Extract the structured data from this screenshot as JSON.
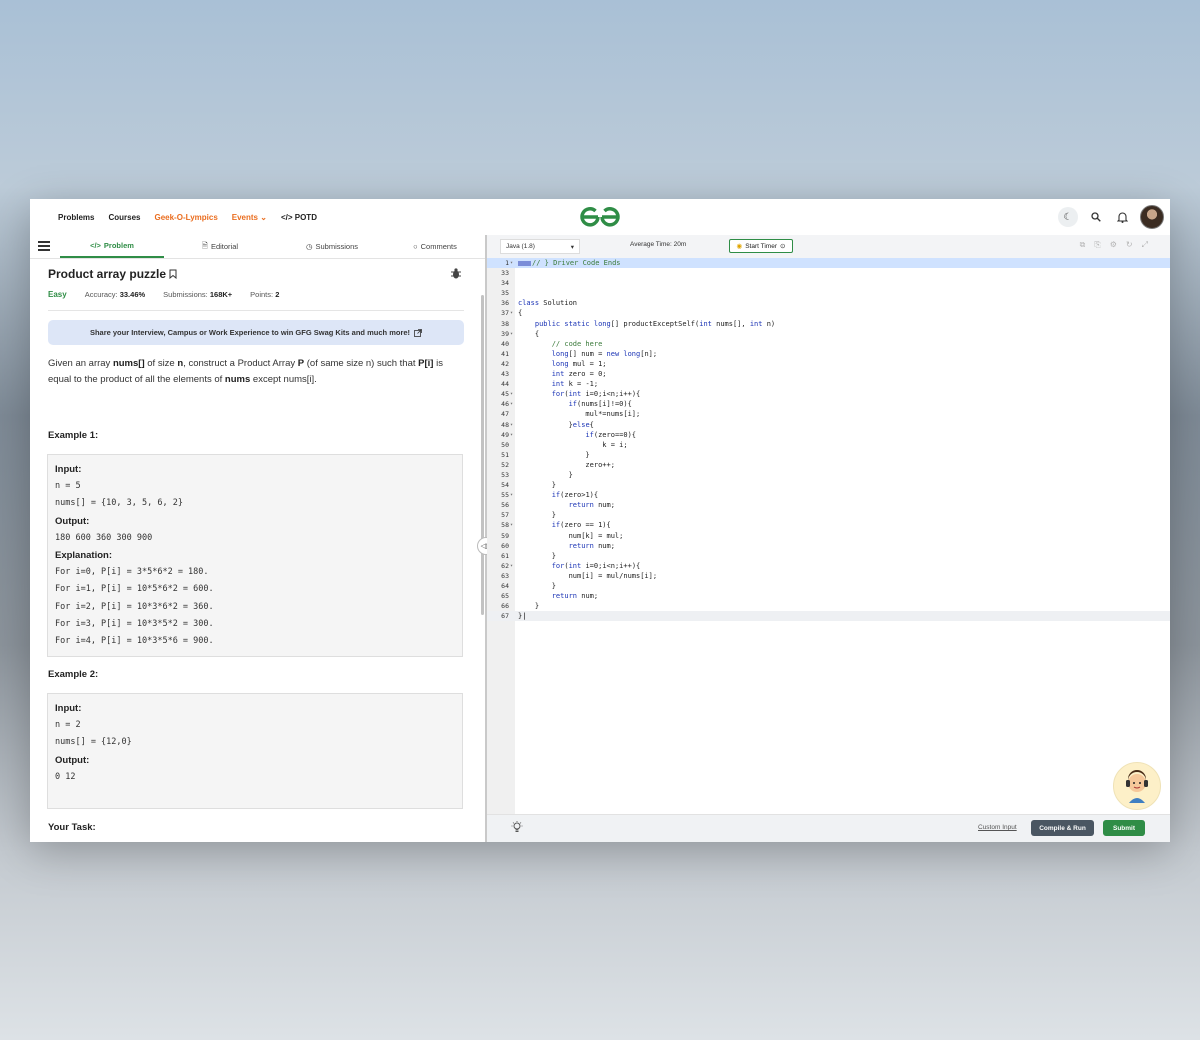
{
  "nav": {
    "links": [
      "Problems",
      "Courses",
      "Geek-O-Lympics",
      "Events",
      "POTD"
    ],
    "events_chevron": "⌄",
    "potd_prefix": "</>"
  },
  "tabs": {
    "problem": "Problem",
    "editorial": "Editorial",
    "submissions": "Submissions",
    "comments": "Comments"
  },
  "problem": {
    "title": "Product array puzzle",
    "difficulty": "Easy",
    "accuracy_label": "Accuracy:",
    "accuracy": "33.46%",
    "submissions_label": "Submissions:",
    "submissions": "168K+",
    "points_label": "Points:",
    "points": "2",
    "banner": "Share your Interview, Campus or Work Experience to win GFG Swag Kits and much more!",
    "desc": {
      "p1": "Given an array ",
      "b1": "nums[]",
      "p2": " of size ",
      "b2": "n",
      "p3": ", construct a Product Array ",
      "b3": "P",
      "p4": " (of same size n) such that ",
      "b4": "P[i]",
      "p5": " is equal to the product of all the elements of ",
      "b5": "nums",
      "p6": " except nums[i]."
    },
    "example1": {
      "heading": "Example 1:",
      "input_label": "Input:",
      "input_lines": [
        "n = 5",
        "nums[] = {10, 3, 5, 6, 2}"
      ],
      "output_label": "Output:",
      "output": "180 600 360 300 900",
      "explanation_label": "Explanation:",
      "explanation_lines": [
        "For i=0, P[i] = 3*5*6*2 = 180.",
        "For i=1, P[i] = 10*5*6*2 = 600.",
        "For i=2, P[i] = 10*3*6*2 = 360.",
        "For i=3, P[i] = 10*3*5*2 = 300.",
        "For i=4, P[i] = 10*3*5*6 = 900."
      ]
    },
    "example2": {
      "heading": "Example 2:",
      "input_label": "Input:",
      "input_lines": [
        "n = 2",
        "nums[] = {12,0}"
      ],
      "output_label": "Output:",
      "output": "0 12"
    },
    "your_task": "Your Task:"
  },
  "editor": {
    "language": "Java (1.8)",
    "avg_time": "Average Time: 20m",
    "start_timer": "Start Timer",
    "lines": [
      {
        "n": "1",
        "fold": true,
        "segs": [
          [
            "marker",
            ""
          ],
          [
            "cm",
            "// } Driver Code Ends"
          ]
        ],
        "hl": true
      },
      {
        "n": "33",
        "segs": []
      },
      {
        "n": "34",
        "segs": []
      },
      {
        "n": "35",
        "segs": []
      },
      {
        "n": "36",
        "segs": [
          [
            "kw",
            "class"
          ],
          [
            "",
            " Solution"
          ]
        ]
      },
      {
        "n": "37",
        "fold": true,
        "segs": [
          [
            "",
            "{"
          ]
        ]
      },
      {
        "n": "38",
        "segs": [
          [
            "",
            "    "
          ],
          [
            "kw",
            "public static long"
          ],
          [
            "",
            "[] productExceptSelf("
          ],
          [
            "kw",
            "int"
          ],
          [
            "",
            " nums[], "
          ],
          [
            "kw",
            "int"
          ],
          [
            "",
            " n)"
          ]
        ]
      },
      {
        "n": "39",
        "fold": true,
        "segs": [
          [
            "",
            "    {"
          ]
        ]
      },
      {
        "n": "40",
        "segs": [
          [
            "",
            "        "
          ],
          [
            "cm",
            "// code here"
          ]
        ]
      },
      {
        "n": "41",
        "segs": [
          [
            "",
            "        "
          ],
          [
            "kw",
            "long"
          ],
          [
            "",
            "[] num = "
          ],
          [
            "kw",
            "new long"
          ],
          [
            "",
            "[n];"
          ]
        ]
      },
      {
        "n": "42",
        "segs": [
          [
            "",
            "        "
          ],
          [
            "kw",
            "long"
          ],
          [
            "",
            " mul = 1;"
          ]
        ]
      },
      {
        "n": "43",
        "segs": [
          [
            "",
            "        "
          ],
          [
            "kw",
            "int"
          ],
          [
            "",
            " zero = 0;"
          ]
        ]
      },
      {
        "n": "44",
        "segs": [
          [
            "",
            "        "
          ],
          [
            "kw",
            "int"
          ],
          [
            "",
            " k = -1;"
          ]
        ]
      },
      {
        "n": "45",
        "fold": true,
        "segs": [
          [
            "",
            "        "
          ],
          [
            "kw",
            "for"
          ],
          [
            "",
            "("
          ],
          [
            "kw",
            "int"
          ],
          [
            "",
            " i=0;i<n;i++){"
          ]
        ]
      },
      {
        "n": "46",
        "fold": true,
        "segs": [
          [
            "",
            "            "
          ],
          [
            "kw",
            "if"
          ],
          [
            "",
            "(nums[i]!=0){"
          ]
        ]
      },
      {
        "n": "47",
        "segs": [
          [
            "",
            "                mul*=nums[i];"
          ]
        ]
      },
      {
        "n": "48",
        "fold": true,
        "segs": [
          [
            "",
            "            }"
          ],
          [
            "kw",
            "else"
          ],
          [
            "",
            "{"
          ]
        ]
      },
      {
        "n": "49",
        "fold": true,
        "segs": [
          [
            "",
            "                "
          ],
          [
            "kw",
            "if"
          ],
          [
            "",
            "(zero==0){"
          ]
        ]
      },
      {
        "n": "50",
        "segs": [
          [
            "",
            "                    k = i;"
          ]
        ]
      },
      {
        "n": "51",
        "segs": [
          [
            "",
            "                }"
          ]
        ]
      },
      {
        "n": "52",
        "segs": [
          [
            "",
            "                zero++;"
          ]
        ]
      },
      {
        "n": "53",
        "segs": [
          [
            "",
            "            }"
          ]
        ]
      },
      {
        "n": "54",
        "segs": [
          [
            "",
            "        }"
          ]
        ]
      },
      {
        "n": "55",
        "fold": true,
        "segs": [
          [
            "",
            "        "
          ],
          [
            "kw",
            "if"
          ],
          [
            "",
            "(zero>1){"
          ]
        ]
      },
      {
        "n": "56",
        "segs": [
          [
            "",
            "            "
          ],
          [
            "kw",
            "return"
          ],
          [
            "",
            " num;"
          ]
        ]
      },
      {
        "n": "57",
        "segs": [
          [
            "",
            "        }"
          ]
        ]
      },
      {
        "n": "58",
        "fold": true,
        "segs": [
          [
            "",
            "        "
          ],
          [
            "kw",
            "if"
          ],
          [
            "",
            "(zero == 1){"
          ]
        ]
      },
      {
        "n": "59",
        "segs": [
          [
            "",
            "            num[k] = mul;"
          ]
        ]
      },
      {
        "n": "60",
        "segs": [
          [
            "",
            "            "
          ],
          [
            "kw",
            "return"
          ],
          [
            "",
            " num;"
          ]
        ]
      },
      {
        "n": "61",
        "segs": [
          [
            "",
            "        }"
          ]
        ]
      },
      {
        "n": "62",
        "fold": true,
        "segs": [
          [
            "",
            "        "
          ],
          [
            "kw",
            "for"
          ],
          [
            "",
            "("
          ],
          [
            "kw",
            "int"
          ],
          [
            "",
            " i=0;i<n;i++){"
          ]
        ]
      },
      {
        "n": "63",
        "segs": [
          [
            "",
            "            num[i] = mul/nums[i];"
          ]
        ]
      },
      {
        "n": "64",
        "segs": [
          [
            "",
            "        }"
          ]
        ]
      },
      {
        "n": "65",
        "segs": [
          [
            "",
            "        "
          ],
          [
            "kw",
            "return"
          ],
          [
            "",
            " num;"
          ]
        ]
      },
      {
        "n": "66",
        "segs": [
          [
            "",
            "    }"
          ]
        ]
      },
      {
        "n": "67",
        "segs": [
          [
            "",
            "}"
          ]
        ],
        "cur": true
      }
    ]
  },
  "footer": {
    "custom_input": "Custom Input",
    "compile_run": "Compile & Run",
    "submit": "Submit"
  },
  "colors": {
    "brand_green": "#2f8d46",
    "accent_orange": "#ea6d1f",
    "banner_bg": "#dde6f7",
    "compile_bg": "#4a5662"
  },
  "icons": [
    "moon-icon",
    "search-icon",
    "bell-icon",
    "bookmark-icon",
    "bug-icon",
    "external-link-icon",
    "lightbulb-icon",
    "chatbot-avatar-icon"
  ]
}
